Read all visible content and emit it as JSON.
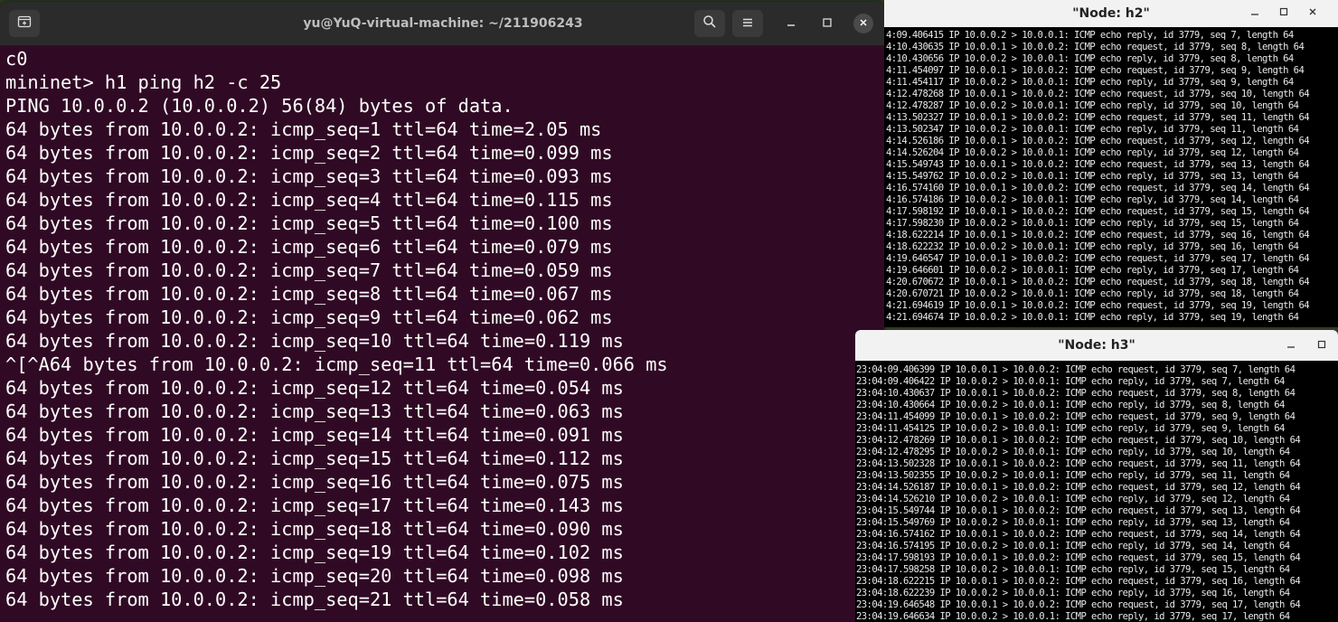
{
  "terminal": {
    "title": "yu@YuQ-virtual-machine: ~/211906243",
    "lines": [
      "c0",
      "mininet> h1 ping h2 -c 25",
      "PING 10.0.0.2 (10.0.0.2) 56(84) bytes of data.",
      "64 bytes from 10.0.0.2: icmp_seq=1 ttl=64 time=2.05 ms",
      "64 bytes from 10.0.0.2: icmp_seq=2 ttl=64 time=0.099 ms",
      "64 bytes from 10.0.0.2: icmp_seq=3 ttl=64 time=0.093 ms",
      "64 bytes from 10.0.0.2: icmp_seq=4 ttl=64 time=0.115 ms",
      "64 bytes from 10.0.0.2: icmp_seq=5 ttl=64 time=0.100 ms",
      "64 bytes from 10.0.0.2: icmp_seq=6 ttl=64 time=0.079 ms",
      "64 bytes from 10.0.0.2: icmp_seq=7 ttl=64 time=0.059 ms",
      "64 bytes from 10.0.0.2: icmp_seq=8 ttl=64 time=0.067 ms",
      "64 bytes from 10.0.0.2: icmp_seq=9 ttl=64 time=0.062 ms",
      "64 bytes from 10.0.0.2: icmp_seq=10 ttl=64 time=0.119 ms",
      "^[^A64 bytes from 10.0.0.2: icmp_seq=11 ttl=64 time=0.066 ms",
      "64 bytes from 10.0.0.2: icmp_seq=12 ttl=64 time=0.054 ms",
      "64 bytes from 10.0.0.2: icmp_seq=13 ttl=64 time=0.063 ms",
      "64 bytes from 10.0.0.2: icmp_seq=14 ttl=64 time=0.091 ms",
      "64 bytes from 10.0.0.2: icmp_seq=15 ttl=64 time=0.112 ms",
      "64 bytes from 10.0.0.2: icmp_seq=16 ttl=64 time=0.075 ms",
      "64 bytes from 10.0.0.2: icmp_seq=17 ttl=64 time=0.143 ms",
      "64 bytes from 10.0.0.2: icmp_seq=18 ttl=64 time=0.090 ms",
      "64 bytes from 10.0.0.2: icmp_seq=19 ttl=64 time=0.102 ms",
      "64 bytes from 10.0.0.2: icmp_seq=20 ttl=64 time=0.098 ms",
      "64 bytes from 10.0.0.2: icmp_seq=21 ttl=64 time=0.058 ms"
    ],
    "icons": {
      "new_tab": "new-tab-icon",
      "search": "search-icon",
      "menu": "hamburger-menu-icon",
      "minimize": "minimize-icon",
      "maximize": "maximize-icon",
      "close": "close-icon"
    },
    "colors": {
      "background": "#300a24",
      "header": "#2b2b2b",
      "text": "#ffffff"
    }
  },
  "node_h2": {
    "title": "\"Node: h2\"",
    "lines": [
      "4:09.406415 IP 10.0.0.2 > 10.0.0.1: ICMP echo reply, id 3779, seq 7, length 64",
      "4:10.430635 IP 10.0.0.1 > 10.0.0.2: ICMP echo request, id 3779, seq 8, length 64",
      "4:10.430656 IP 10.0.0.2 > 10.0.0.1: ICMP echo reply, id 3779, seq 8, length 64",
      "4:11.454097 IP 10.0.0.1 > 10.0.0.2: ICMP echo request, id 3779, seq 9, length 64",
      "4:11.454117 IP 10.0.0.2 > 10.0.0.1: ICMP echo reply, id 3779, seq 9, length 64",
      "4:12.478268 IP 10.0.0.1 > 10.0.0.2: ICMP echo request, id 3779, seq 10, length 64",
      "4:12.478287 IP 10.0.0.2 > 10.0.0.1: ICMP echo reply, id 3779, seq 10, length 64",
      "4:13.502327 IP 10.0.0.1 > 10.0.0.2: ICMP echo request, id 3779, seq 11, length 64",
      "4:13.502347 IP 10.0.0.2 > 10.0.0.1: ICMP echo reply, id 3779, seq 11, length 64",
      "4:14.526186 IP 10.0.0.1 > 10.0.0.2: ICMP echo request, id 3779, seq 12, length 64",
      "4:14.526204 IP 10.0.0.2 > 10.0.0.1: ICMP echo reply, id 3779, seq 12, length 64",
      "4:15.549743 IP 10.0.0.1 > 10.0.0.2: ICMP echo request, id 3779, seq 13, length 64",
      "4:15.549762 IP 10.0.0.2 > 10.0.0.1: ICMP echo reply, id 3779, seq 13, length 64",
      "4:16.574160 IP 10.0.0.1 > 10.0.0.2: ICMP echo request, id 3779, seq 14, length 64",
      "4:16.574186 IP 10.0.0.2 > 10.0.0.1: ICMP echo reply, id 3779, seq 14, length 64",
      "4:17.598192 IP 10.0.0.1 > 10.0.0.2: ICMP echo request, id 3779, seq 15, length 64",
      "4:17.598230 IP 10.0.0.2 > 10.0.0.1: ICMP echo reply, id 3779, seq 15, length 64",
      "4:18.622214 IP 10.0.0.1 > 10.0.0.2: ICMP echo request, id 3779, seq 16, length 64",
      "4:18.622232 IP 10.0.0.2 > 10.0.0.1: ICMP echo reply, id 3779, seq 16, length 64",
      "4:19.646547 IP 10.0.0.1 > 10.0.0.2: ICMP echo request, id 3779, seq 17, length 64",
      "4:19.646601 IP 10.0.0.2 > 10.0.0.1: ICMP echo reply, id 3779, seq 17, length 64",
      "4:20.670672 IP 10.0.0.1 > 10.0.0.2: ICMP echo request, id 3779, seq 18, length 64",
      "4:20.670721 IP 10.0.0.2 > 10.0.0.1: ICMP echo reply, id 3779, seq 18, length 64",
      "4:21.694619 IP 10.0.0.1 > 10.0.0.2: ICMP echo request, id 3779, seq 19, length 64",
      "4:21.694674 IP 10.0.0.2 > 10.0.0.1: ICMP echo reply, id 3779, seq 19, length 64"
    ]
  },
  "node_h3": {
    "title": "\"Node: h3\"",
    "lines": [
      "23:04:09.406399 IP 10.0.0.1 > 10.0.0.2: ICMP echo request, id 3779, seq 7, length 64",
      "23:04:09.406422 IP 10.0.0.2 > 10.0.0.1: ICMP echo reply, id 3779, seq 7, length 64",
      "23:04:10.430637 IP 10.0.0.1 > 10.0.0.2: ICMP echo request, id 3779, seq 8, length 64",
      "23:04:10.430664 IP 10.0.0.2 > 10.0.0.1: ICMP echo reply, id 3779, seq 8, length 64",
      "23:04:11.454099 IP 10.0.0.1 > 10.0.0.2: ICMP echo request, id 3779, seq 9, length 64",
      "23:04:11.454125 IP 10.0.0.2 > 10.0.0.1: ICMP echo reply, id 3779, seq 9, length 64",
      "23:04:12.478269 IP 10.0.0.1 > 10.0.0.2: ICMP echo request, id 3779, seq 10, length 64",
      "23:04:12.478295 IP 10.0.0.2 > 10.0.0.1: ICMP echo reply, id 3779, seq 10, length 64",
      "23:04:13.502328 IP 10.0.0.1 > 10.0.0.2: ICMP echo request, id 3779, seq 11, length 64",
      "23:04:13.502355 IP 10.0.0.2 > 10.0.0.1: ICMP echo reply, id 3779, seq 11, length 64",
      "23:04:14.526187 IP 10.0.0.1 > 10.0.0.2: ICMP echo request, id 3779, seq 12, length 64",
      "23:04:14.526210 IP 10.0.0.2 > 10.0.0.1: ICMP echo reply, id 3779, seq 12, length 64",
      "23:04:15.549744 IP 10.0.0.1 > 10.0.0.2: ICMP echo request, id 3779, seq 13, length 64",
      "23:04:15.549769 IP 10.0.0.2 > 10.0.0.1: ICMP echo reply, id 3779, seq 13, length 64",
      "23:04:16.574162 IP 10.0.0.1 > 10.0.0.2: ICMP echo request, id 3779, seq 14, length 64",
      "23:04:16.574195 IP 10.0.0.2 > 10.0.0.1: ICMP echo reply, id 3779, seq 14, length 64",
      "23:04:17.598193 IP 10.0.0.1 > 10.0.0.2: ICMP echo request, id 3779, seq 15, length 64",
      "23:04:17.598258 IP 10.0.0.2 > 10.0.0.1: ICMP echo reply, id 3779, seq 15, length 64",
      "23:04:18.622215 IP 10.0.0.1 > 10.0.0.2: ICMP echo request, id 3779, seq 16, length 64",
      "23:04:18.622239 IP 10.0.0.2 > 10.0.0.1: ICMP echo reply, id 3779, seq 16, length 64",
      "23:04:19.646548 IP 10.0.0.1 > 10.0.0.2: ICMP echo request, id 3779, seq 17, length 64",
      "23:04:19.646634 IP 10.0.0.2 > 10.0.0.1: ICMP echo reply, id 3779, seq 17, length 64"
    ]
  }
}
